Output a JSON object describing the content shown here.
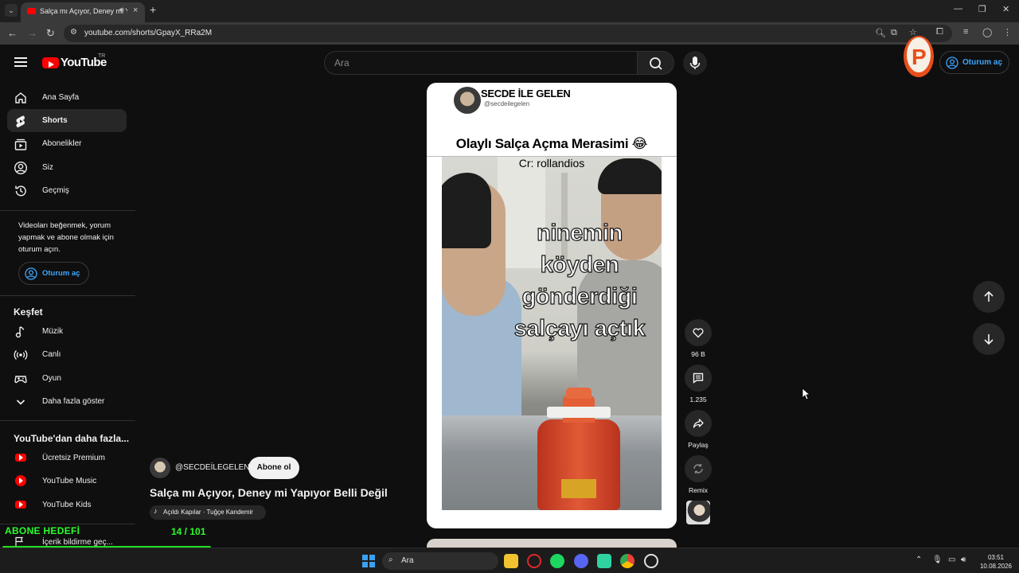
{
  "browser": {
    "tab_title": "Salça mı Açıyor, Deney mi Yapıyor Belli Değil - YouTube",
    "url": "youtube.com/shorts/GpayX_RRa2M"
  },
  "header": {
    "logo_text": "YouTube",
    "country_code": "TR",
    "search_placeholder": "Ara",
    "signin_label": "Oturum aç"
  },
  "sidebar": {
    "main_items": [
      {
        "label": "Ana Sayfa",
        "icon": "home-icon"
      },
      {
        "label": "Shorts",
        "icon": "shorts-icon",
        "active": true
      },
      {
        "label": "Abonelikler",
        "icon": "subscriptions-icon"
      },
      {
        "label": "Siz",
        "icon": "you-icon"
      },
      {
        "label": "Geçmiş",
        "icon": "history-icon"
      }
    ],
    "signin_prompt": "Videoları beğenmek, yorum yapmak ve abone olmak için oturum açın.",
    "signin_label": "Oturum aç",
    "explore_title": "Keşfet",
    "explore_items": [
      {
        "label": "Müzik",
        "icon": "music-icon"
      },
      {
        "label": "Canlı",
        "icon": "live-icon"
      },
      {
        "label": "Oyun",
        "icon": "gaming-icon"
      },
      {
        "label": "Daha fazla göster",
        "icon": "chevron-down-icon"
      }
    ],
    "more_title": "YouTube'dan daha fazla...",
    "more_items": [
      {
        "label": "Ücretsiz Premium",
        "icon": "youtube-premium-icon"
      },
      {
        "label": "YouTube Music",
        "icon": "youtube-music-icon"
      },
      {
        "label": "YouTube Kids",
        "icon": "youtube-kids-icon"
      }
    ],
    "report_label": "İçerik bildirme geç..."
  },
  "short": {
    "card_channel": "SECDE İLE GELEN",
    "card_handle": "@secdeilegelen",
    "card_headline": "Olaylı Salça Açma Merasimi 😂",
    "video_credit": "Cr: rollandios",
    "video_caption": "ninemin köyden gönderdiği salçayı açtık",
    "channel_handle": "@SECDEİLEGELEN",
    "subscribe_label": "Abone ol",
    "title": "Salça mı Açıyor, Deney mi Yapıyor Belli Değil",
    "sound_label": "Açıldı Kapılar · Tuğçe Kandemir"
  },
  "actions": {
    "like_count": "96 B",
    "comment_count": "1.235",
    "share_label": "Paylaş",
    "remix_label": "Remix"
  },
  "overlay": {
    "goal_title": "ABONE HEDEFİ",
    "goal_count": "14 / 101",
    "goal_progress": 0.139
  },
  "taskbar": {
    "search_label": "Ara",
    "time": "03:51",
    "date": "10.08.2026"
  },
  "colors": {
    "accent_link": "#3ea6ff",
    "youtube_red": "#ff0000",
    "overlay_green": "#2aff2a"
  }
}
